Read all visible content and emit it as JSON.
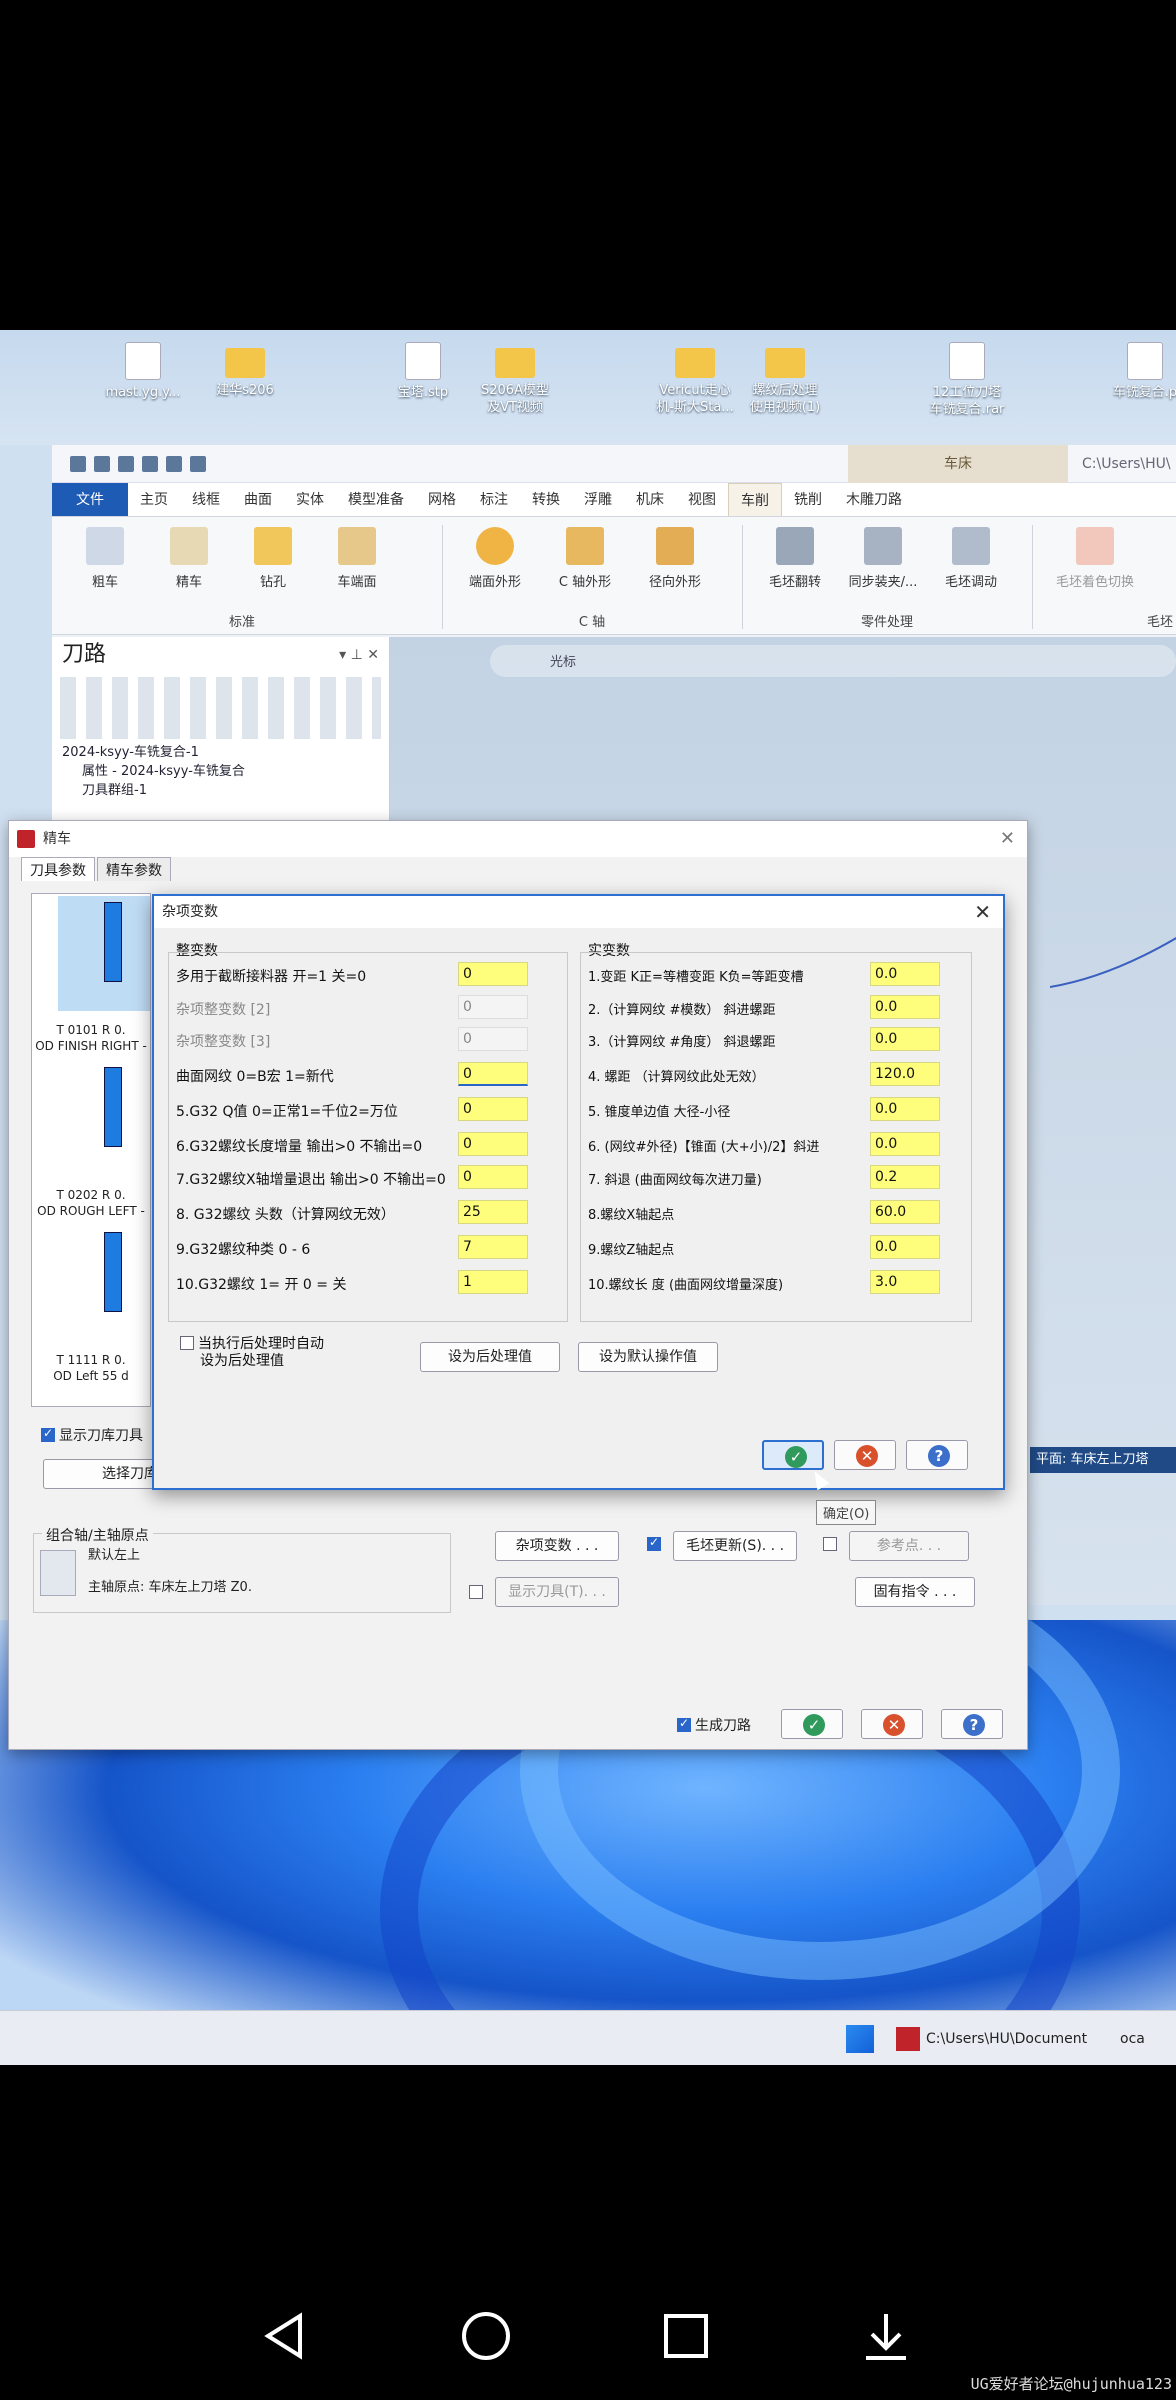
{
  "desktop": {
    "icons": [
      {
        "label": "mast.yg.y..."
      },
      {
        "label": "建华s206"
      },
      {
        "label": "宝塔.stp"
      },
      {
        "label": "S206A模型\n及VT视频"
      },
      {
        "label": "Vericut走心\n机-斯大Sta..."
      },
      {
        "label": "螺纹后处理\n使用视频(1)"
      },
      {
        "label": "12工位刀塔\n车铣复合.rar"
      },
      {
        "label": "车铣复合.p"
      }
    ]
  },
  "cam": {
    "context_tab": "车床",
    "path": "C:\\Users\\HU\\",
    "menu": [
      "文件",
      "主页",
      "线框",
      "曲面",
      "实体",
      "模型准备",
      "网格",
      "标注",
      "转换",
      "浮雕",
      "机床",
      "视图",
      "车削",
      "铣削",
      "木雕刀路"
    ],
    "ribbon": {
      "buttons": [
        "粗车",
        "精车",
        "钻孔",
        "车端面",
        "端面外形",
        "C 轴外形",
        "径向外形",
        "毛坯翻转",
        "同步装夹/...",
        "毛坯调动",
        "毛坯着色切换"
      ],
      "groups": [
        "标准",
        "C 轴",
        "零件处理",
        "毛坯"
      ]
    },
    "toolpath_panel": {
      "title": "刀路",
      "tree": [
        "2024-ksyy-车铣复合-1",
        "属性 - 2024-ksyy-车铣复合",
        "刀具群组-1"
      ]
    },
    "viewbar_label": "光标",
    "status_plane": "平面: 车床左上刀塔"
  },
  "finish_dialog": {
    "title": "精车",
    "tabs": [
      "刀具参数",
      "精车参数"
    ],
    "tools": [
      {
        "line1": "T 0101 R 0.",
        "line2": "OD FINISH RIGHT -"
      },
      {
        "line1": "T 0202 R 0.",
        "line2": "OD ROUGH LEFT -"
      },
      {
        "line1": "T 1111 R 0.",
        "line2": "OD Left 55 d"
      }
    ],
    "show_library_tools": "显示刀库刀具",
    "select_library": "选择刀库刀",
    "origin_frame": "组合轴/主轴原点",
    "origin_default": "默认左上",
    "spindle_origin": "主轴原点: 车床左上刀塔  Z0.",
    "misc_button": "杂项变数 . . .",
    "stock_update": "毛坯更新(S). . .",
    "reference_point": "参考点. . .",
    "show_tool": "显示刀具(T). . .",
    "canned": "固有指令 . . .",
    "generate_toolpath": "生成刀路"
  },
  "misc_dialog": {
    "title": "杂项变数",
    "int_header": "整变数",
    "real_header": "实变数",
    "int_rows": [
      {
        "label": "多用于截断接料器 开=1 关=0",
        "value": "0",
        "disabled": false
      },
      {
        "label": "杂项整变数 [2]",
        "value": "0",
        "disabled": true
      },
      {
        "label": "杂项整变数 [3]",
        "value": "0",
        "disabled": true
      },
      {
        "label": "曲面网纹  0=B宏   1=新代",
        "value": "0",
        "disabled": false
      },
      {
        "label": "5.G32 Q值 0=正常1=千位2=万位",
        "value": "0",
        "disabled": false
      },
      {
        "label": "6.G32螺纹长度增量   输出>0    不输出=0",
        "value": "0",
        "disabled": false
      },
      {
        "label": "7.G32螺纹X轴增量退出  输出>0   不输出=0",
        "value": "0",
        "disabled": false
      },
      {
        "label": "8. G32螺纹 头数（计算网纹无效）",
        "value": "25",
        "disabled": false
      },
      {
        "label": "9.G32螺纹种类           0 - 6",
        "value": "7",
        "disabled": false
      },
      {
        "label": "10.G32螺纹 1= 开 0 = 关",
        "value": "1",
        "disabled": false
      }
    ],
    "real_rows": [
      {
        "label": "1.变距  K正=等槽变距  K负=等距变槽",
        "value": "0.0"
      },
      {
        "label": "2.（计算网纹 #模数）    斜进螺距",
        "value": "0.0"
      },
      {
        "label": "3.（计算网纹 #角度）    斜退螺距",
        "value": "0.0"
      },
      {
        "label": "4.   螺距  （计算网纹此处无效）",
        "value": "120.0"
      },
      {
        "label": "5. 锥度单边值 大径-小径",
        "value": "0.0"
      },
      {
        "label": "6. (网纹#外径)【锥面 (大+小)/2】斜进",
        "value": "0.0"
      },
      {
        "label": "7.   斜退  (曲面网纹每次进刀量)",
        "value": "0.2"
      },
      {
        "label": "8.螺纹X轴起点",
        "value": "60.0"
      },
      {
        "label": "9.螺纹Z轴起点",
        "value": "0.0"
      },
      {
        "label": "10.螺纹长 度   (曲面网纹增量深度)",
        "value": "3.0"
      }
    ],
    "auto_post_line1": "当执行后处理时自动",
    "auto_post_line2": "设为后处理值",
    "set_post_button": "设为后处理值",
    "set_default_button": "设为默认操作值",
    "tooltip": "确定(O)"
  },
  "taskbar": {
    "app_label": "C:\\Users\\HU\\Document",
    "app2_label": "oca"
  },
  "watermark": "UG爱好者论坛@hujunhua123"
}
